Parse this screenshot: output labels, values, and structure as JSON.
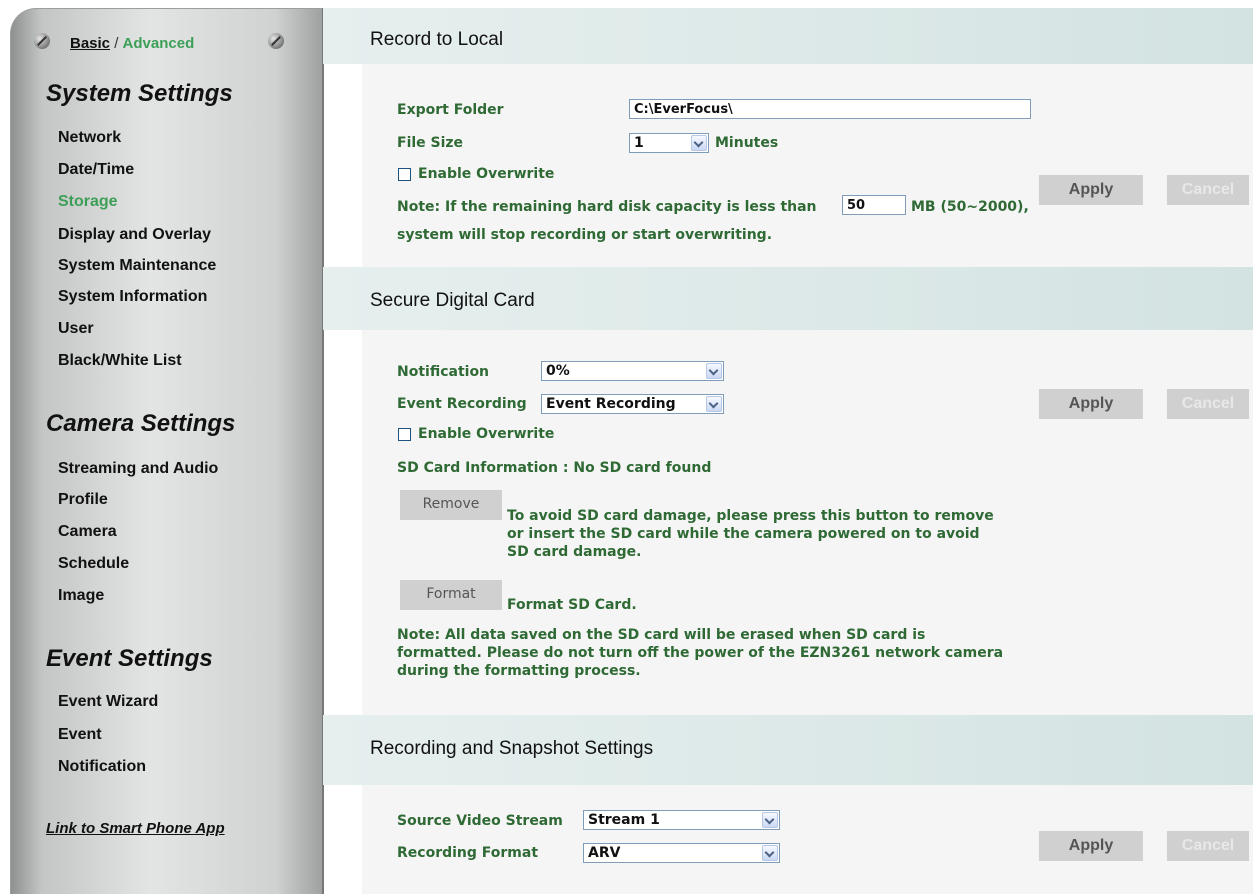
{
  "sidebar": {
    "mode_basic": "Basic",
    "mode_sep": " / ",
    "mode_advanced": "Advanced",
    "sections": {
      "system": {
        "title": "System Settings",
        "items": [
          "Network",
          "Date/Time",
          "Storage",
          "Display and Overlay",
          "System Maintenance",
          "System Information",
          "User",
          "Black/White List"
        ]
      },
      "camera": {
        "title": "Camera Settings",
        "items": [
          "Streaming and Audio",
          "Profile",
          "Camera",
          "Schedule",
          "Image"
        ]
      },
      "event": {
        "title": "Event Settings",
        "items": [
          "Event Wizard",
          "Event",
          "Notification"
        ]
      }
    },
    "active_item": "Storage",
    "app_link": "Link to Smart Phone App"
  },
  "record_local": {
    "title": "Record to Local",
    "export_label": "Export Folder",
    "export_value": "C:\\EverFocus\\",
    "filesize_label": "File Size",
    "filesize_value": "1",
    "filesize_unit": "Minutes",
    "overwrite_label": "Enable Overwrite",
    "note_prefix": "Note: If the remaining hard disk capacity is less than",
    "capacity_value": "50",
    "note_suffix": "MB (50~2000),",
    "note_line2": "system will stop recording or start overwriting.",
    "apply": "Apply",
    "cancel": "Cancel"
  },
  "sd_card": {
    "title": "Secure Digital Card",
    "notification_label": "Notification",
    "notification_value": "0%",
    "event_label": "Event Recording",
    "event_value": "Event Recording",
    "overwrite_label": "Enable Overwrite",
    "info": "SD Card Information : No SD card found",
    "remove_button": "Remove",
    "remove_text1": "To avoid SD card damage, please press this button to remove",
    "remove_text2": "or insert the SD card while the camera powered on to avoid",
    "remove_text3": "SD card damage.",
    "format_button": "Format",
    "format_text": "Format SD Card.",
    "note1": "Note: All data saved on the SD card will be erased when SD card is",
    "note2": "formatted. Please do not turn off the power of the EZN3261 network camera",
    "note3": "during the formatting process.",
    "apply": "Apply",
    "cancel": "Cancel"
  },
  "recording": {
    "title": "Recording and Snapshot Settings",
    "source_label": "Source Video Stream",
    "source_value": "Stream 1",
    "format_label": "Recording Format",
    "format_value": "ARV",
    "apply": "Apply",
    "cancel": "Cancel"
  },
  "colors": {
    "accent_green": "#3d9f57",
    "label_green": "#2f6a35"
  }
}
